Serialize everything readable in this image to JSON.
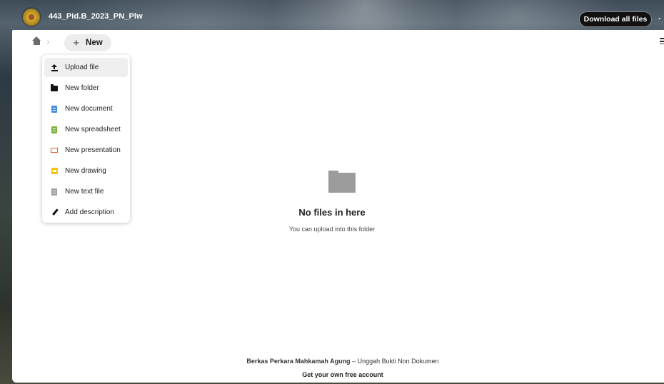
{
  "header": {
    "title": "443_Pid.B_2023_PN_Plw",
    "download_label": "Download all files",
    "more_label": "·",
    "logo_icon": "court-seal-logo"
  },
  "toolbar": {
    "new_label": "New",
    "new_icon": "plus-icon",
    "home_icon": "home-icon",
    "view_icon": "grid-view-icon"
  },
  "menu": {
    "items": [
      {
        "label": "Upload file",
        "icon": "upload-icon",
        "color": "#111111"
      },
      {
        "label": "New folder",
        "icon": "folder-icon",
        "color": "#111111"
      },
      {
        "label": "New document",
        "icon": "document-icon",
        "color": "#4a90d9"
      },
      {
        "label": "New spreadsheet",
        "icon": "spreadsheet-icon",
        "color": "#7cb342"
      },
      {
        "label": "New presentation",
        "icon": "presentation-icon",
        "color": "#e85c2b"
      },
      {
        "label": "New drawing",
        "icon": "drawing-icon",
        "color": "#f2c40f"
      },
      {
        "label": "New text file",
        "icon": "text-file-icon",
        "color": "#9e9e9e"
      },
      {
        "label": "Add description",
        "icon": "pencil-icon",
        "color": "#111111"
      }
    ]
  },
  "empty": {
    "title": "No files in here",
    "subtitle": "You can upload into this folder",
    "icon": "folder-icon"
  },
  "footer": {
    "brand": "Berkas Perkara Mahkamah Agung",
    "separator": " – ",
    "tagline": "Unggah Bukti Non Dokumen",
    "signup": "Get your own free account"
  }
}
